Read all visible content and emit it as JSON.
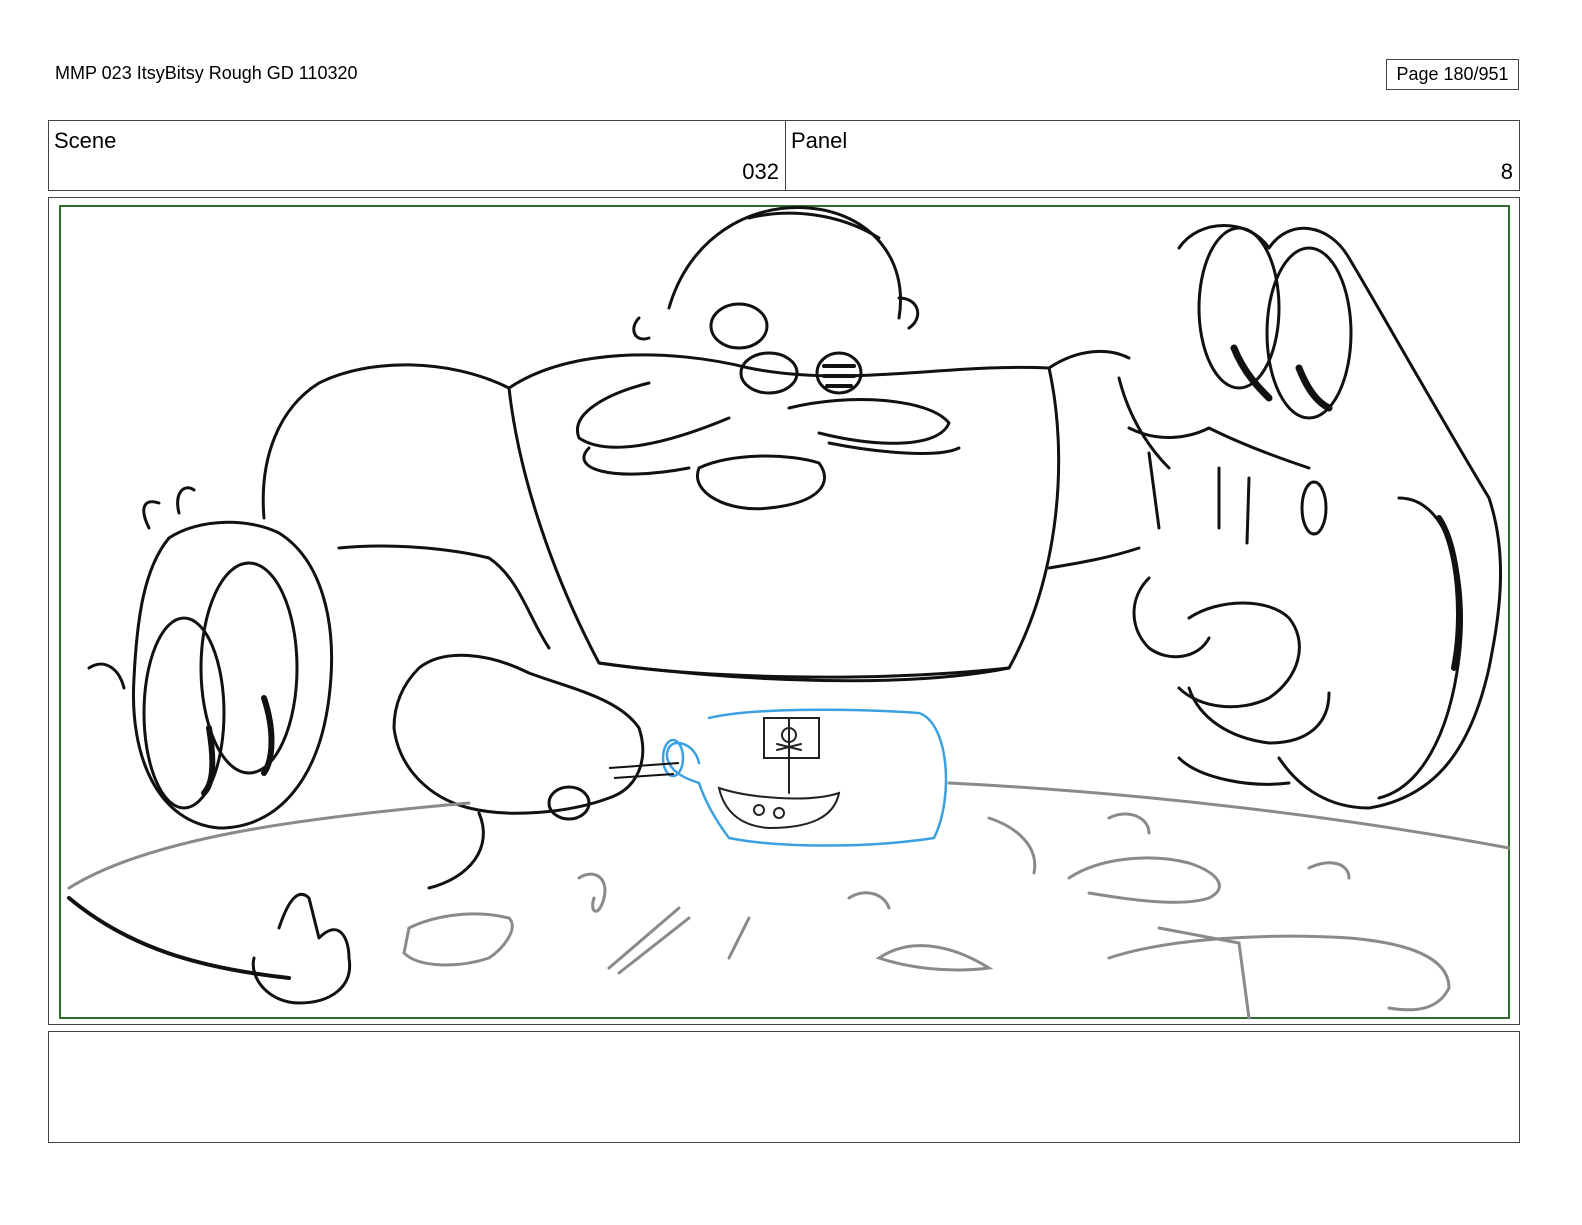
{
  "header": {
    "document_title": "MMP 023 ItsyBitsy Rough GD 110320",
    "page_label": "Page 180/951"
  },
  "info": {
    "scene_label": "Scene",
    "scene_value": "032",
    "panel_label": "Panel",
    "panel_value": "8"
  },
  "frame": {
    "border_color": "#2e6b2e",
    "line_color": "#111111",
    "table_line_color": "#8a8a8a",
    "accent_color": "#3aa0e0"
  },
  "notes": {
    "text": ""
  }
}
